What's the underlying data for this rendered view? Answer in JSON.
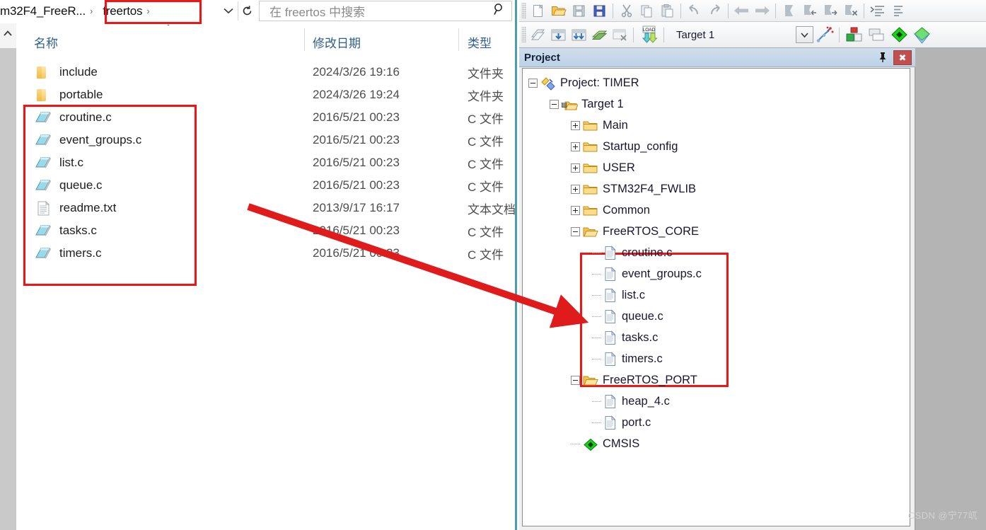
{
  "explorer": {
    "breadcrumb": {
      "parent_label": "m32F4_FreeR...",
      "sep1": "›",
      "current_label": "freertos",
      "sep2": "›",
      "dropdown_icon": "chevron-down-icon",
      "refresh_icon": "refresh-icon",
      "updown_icon": "chevron-up-icon"
    },
    "search": {
      "placeholder": "在 freertos 中搜索",
      "icon": "search-icon"
    },
    "nav_scroll_icon": "chevron-up-icon",
    "columns": [
      {
        "key": "name",
        "label": "名称"
      },
      {
        "key": "date",
        "label": "修改日期"
      },
      {
        "key": "type",
        "label": "类型"
      }
    ],
    "rows": [
      {
        "name": "include",
        "date": "2024/3/26 19:16",
        "type": "文件夹",
        "icon": "folder-icon"
      },
      {
        "name": "portable",
        "date": "2024/3/26 19:24",
        "type": "文件夹",
        "icon": "folder-icon"
      },
      {
        "name": "croutine.c",
        "date": "2016/5/21 00:23",
        "type": "C 文件",
        "icon": "c-file-icon"
      },
      {
        "name": "event_groups.c",
        "date": "2016/5/21 00:23",
        "type": "C 文件",
        "icon": "c-file-icon"
      },
      {
        "name": "list.c",
        "date": "2016/5/21 00:23",
        "type": "C 文件",
        "icon": "c-file-icon"
      },
      {
        "name": "queue.c",
        "date": "2016/5/21 00:23",
        "type": "C 文件",
        "icon": "c-file-icon"
      },
      {
        "name": "readme.txt",
        "date": "2013/9/17 16:17",
        "type": "文本文档",
        "icon": "text-file-icon"
      },
      {
        "name": "tasks.c",
        "date": "2016/5/21 00:23",
        "type": "C 文件",
        "icon": "c-file-icon"
      },
      {
        "name": "timers.c",
        "date": "2016/5/21 00:23",
        "type": "C 文件",
        "icon": "c-file-icon"
      }
    ]
  },
  "keil": {
    "toolbar_row1_icons": [
      "new-file-icon",
      "open-file-icon",
      "save-icon",
      "save-all-icon",
      "cut-icon",
      "copy-icon",
      "paste-icon",
      "undo-icon",
      "redo-icon",
      "navigate-back-icon",
      "navigate-forward-icon",
      "bookmark-toggle-icon",
      "bookmark-prev-icon",
      "bookmark-next-icon",
      "bookmark-clear-icon",
      "indent-icon"
    ],
    "toolbar_row2_icons": [
      "translate-icon",
      "build-icon",
      "rebuild-icon",
      "batch-build-icon",
      "stop-build-icon",
      "download-icon"
    ],
    "target_select": {
      "value": "Target 1",
      "arrow_icon": "chevron-down-icon"
    },
    "toolbar_row2_right_icons": [
      "target-options-icon",
      "manage-project-items-icon",
      "manage-run-time-env-icon",
      "pack-installer-icon"
    ],
    "project_panel": {
      "title": "Project",
      "pin_icon": "pin-icon",
      "close_icon": "close-icon",
      "tree": [
        {
          "depth": 0,
          "label": "Project: TIMER",
          "state": "minus",
          "icon": "project-icon"
        },
        {
          "depth": 1,
          "label": "Target 1",
          "state": "minus",
          "icon": "target-folder-icon"
        },
        {
          "depth": 2,
          "label": "Main",
          "state": "plus",
          "icon": "folder-icon"
        },
        {
          "depth": 2,
          "label": "Startup_config",
          "state": "plus",
          "icon": "folder-icon"
        },
        {
          "depth": 2,
          "label": "USER",
          "state": "plus",
          "icon": "folder-icon"
        },
        {
          "depth": 2,
          "label": "STM32F4_FWLIB",
          "state": "plus",
          "icon": "folder-icon"
        },
        {
          "depth": 2,
          "label": "Common",
          "state": "plus",
          "icon": "folder-icon"
        },
        {
          "depth": 2,
          "label": "FreeRTOS_CORE",
          "state": "minus",
          "icon": "open-folder-icon"
        },
        {
          "depth": 3,
          "label": "croutine.c",
          "state": "leaf",
          "icon": "source-file-icon"
        },
        {
          "depth": 3,
          "label": "event_groups.c",
          "state": "leaf",
          "icon": "source-file-icon"
        },
        {
          "depth": 3,
          "label": "list.c",
          "state": "leaf",
          "icon": "source-file-icon"
        },
        {
          "depth": 3,
          "label": "queue.c",
          "state": "leaf",
          "icon": "source-file-icon"
        },
        {
          "depth": 3,
          "label": "tasks.c",
          "state": "leaf",
          "icon": "source-file-icon"
        },
        {
          "depth": 3,
          "label": "timers.c",
          "state": "leaf",
          "icon": "source-file-icon"
        },
        {
          "depth": 2,
          "label": "FreeRTOS_PORT",
          "state": "minus",
          "icon": "open-folder-icon"
        },
        {
          "depth": 3,
          "label": "heap_4.c",
          "state": "leaf",
          "icon": "source-file-icon"
        },
        {
          "depth": 3,
          "label": "port.c",
          "state": "leaf",
          "icon": "source-file-icon"
        },
        {
          "depth": 2,
          "label": "CMSIS",
          "state": "leaf",
          "icon": "cmsis-icon"
        }
      ]
    }
  },
  "annotations": {
    "highlight_color": "#f01414",
    "arrow_color": "#e01b1b",
    "boxes": [
      {
        "name": "breadcrumb-highlight"
      },
      {
        "name": "explorer-files-highlight"
      },
      {
        "name": "project-tree-files-highlight"
      }
    ],
    "arrow": {
      "from": "explorer-files-highlight",
      "to": "project-tree-files-highlight"
    }
  },
  "watermark": {
    "text": "CSDN @宁77屼"
  }
}
